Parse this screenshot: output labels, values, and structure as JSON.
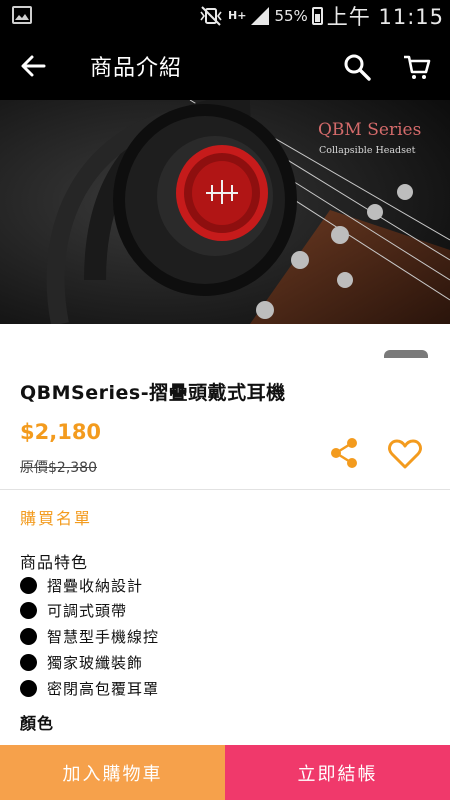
{
  "status_bar": {
    "battery_percent": "55%",
    "network": "H+",
    "time": "上午 11:15",
    "icons": [
      "gallery-notification-icon",
      "mute-vibrate-icon",
      "network-signal-icon",
      "battery-icon"
    ]
  },
  "app_bar": {
    "title": "商品介紹",
    "icons": [
      "back-arrow-icon",
      "search-icon",
      "cart-icon"
    ]
  },
  "hero": {
    "brand": "QBM Series",
    "subtitle": "Collapsible Headset"
  },
  "product": {
    "name": "QBMSeries-摺疊頭戴式耳機",
    "price": "$2,180",
    "original_price": "原價$2,380",
    "action_icons": [
      "share-icon",
      "heart-icon"
    ]
  },
  "wishlist_label": "購買名單",
  "features": {
    "title": "商品特色",
    "items": [
      "摺疊收納設計",
      "可調式頭帶",
      "智慧型手機線控",
      "獨家玻纖裝飾",
      "密閉高包覆耳罩"
    ]
  },
  "color_title": "顏色",
  "buttons": {
    "add_to_cart": "加入購物車",
    "checkout": "立即結帳"
  },
  "colors": {
    "accent_orange": "#f39b1e",
    "cart_button": "#f6a14b",
    "checkout_button": "#f0396b",
    "bar_background": "#000000"
  }
}
